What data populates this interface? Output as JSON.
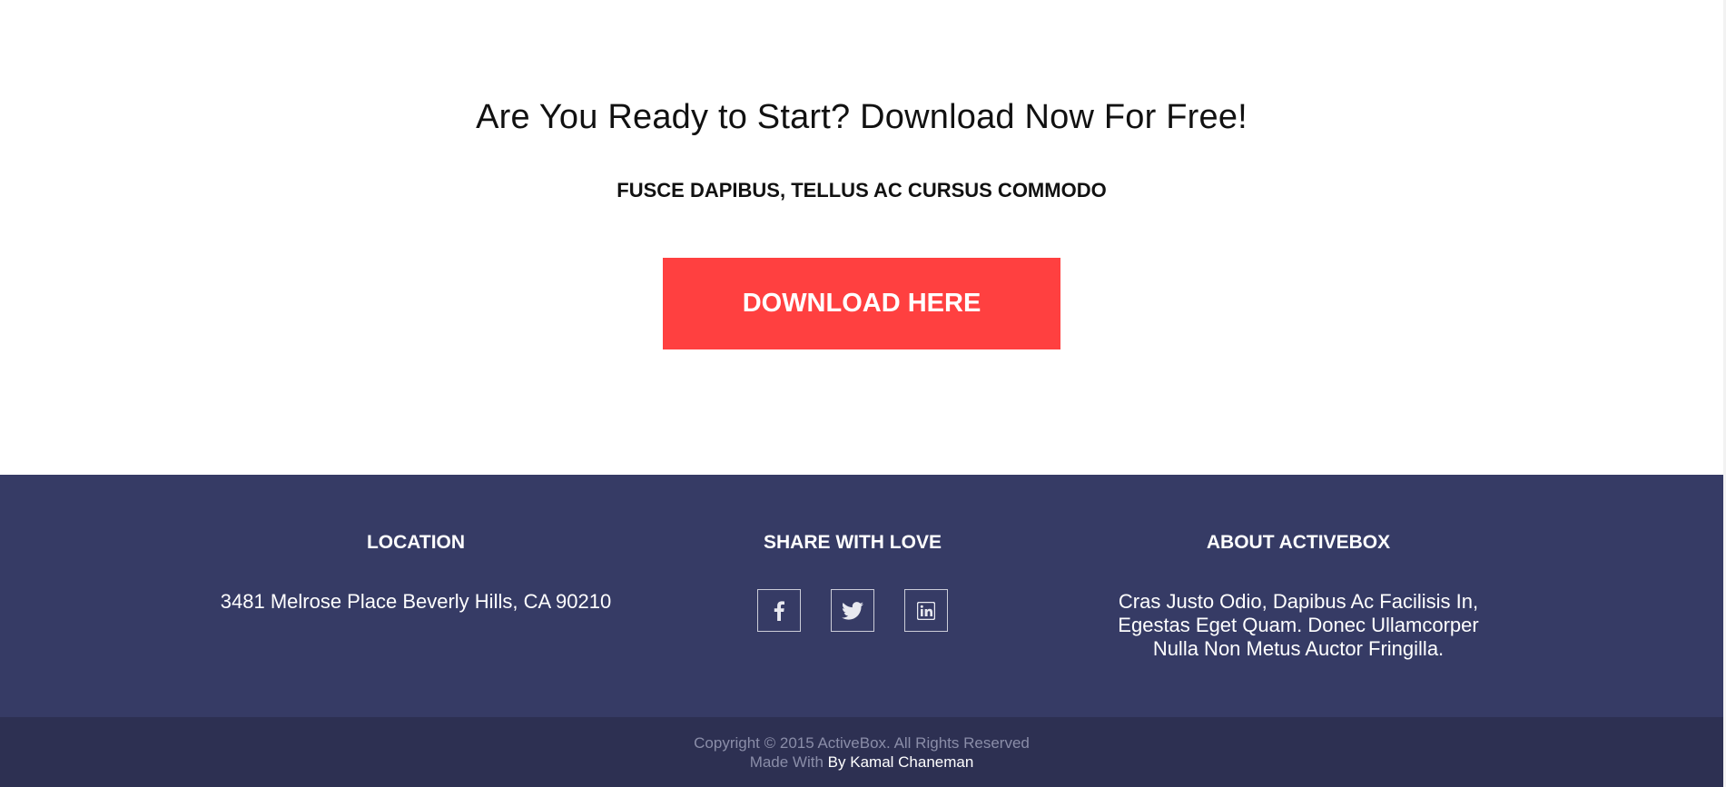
{
  "cta": {
    "title": "Are You Ready to Start? Download Now For Free!",
    "subtitle": "FUSCE DAPIBUS, TELLUS AC CURSUS COMMODO",
    "button_label": "DOWNLOAD HERE"
  },
  "footer": {
    "location": {
      "heading": "LOCATION",
      "address": "3481 Melrose Place Beverly Hills, CA 90210"
    },
    "share": {
      "heading": "SHARE WITH LOVE",
      "icons": [
        "facebook-icon",
        "twitter-icon",
        "linkedin-icon"
      ]
    },
    "about": {
      "heading": "ABOUT ACTIVEBOX",
      "text": "Cras Justo Odio, Dapibus Ac Facilisis In, Egestas Eget Quam. Donec Ullamcorper Nulla Non Metus Auctor Fringilla."
    }
  },
  "bottom": {
    "copyright": "Copyright © 2015 ActiveBox. All Rights Reserved",
    "made_with": "Made With",
    "author": "By Kamal Chaneman"
  },
  "colors": {
    "accent": "#ff4040",
    "footer_bg": "#363b65",
    "bottom_bg": "#2d3052"
  }
}
